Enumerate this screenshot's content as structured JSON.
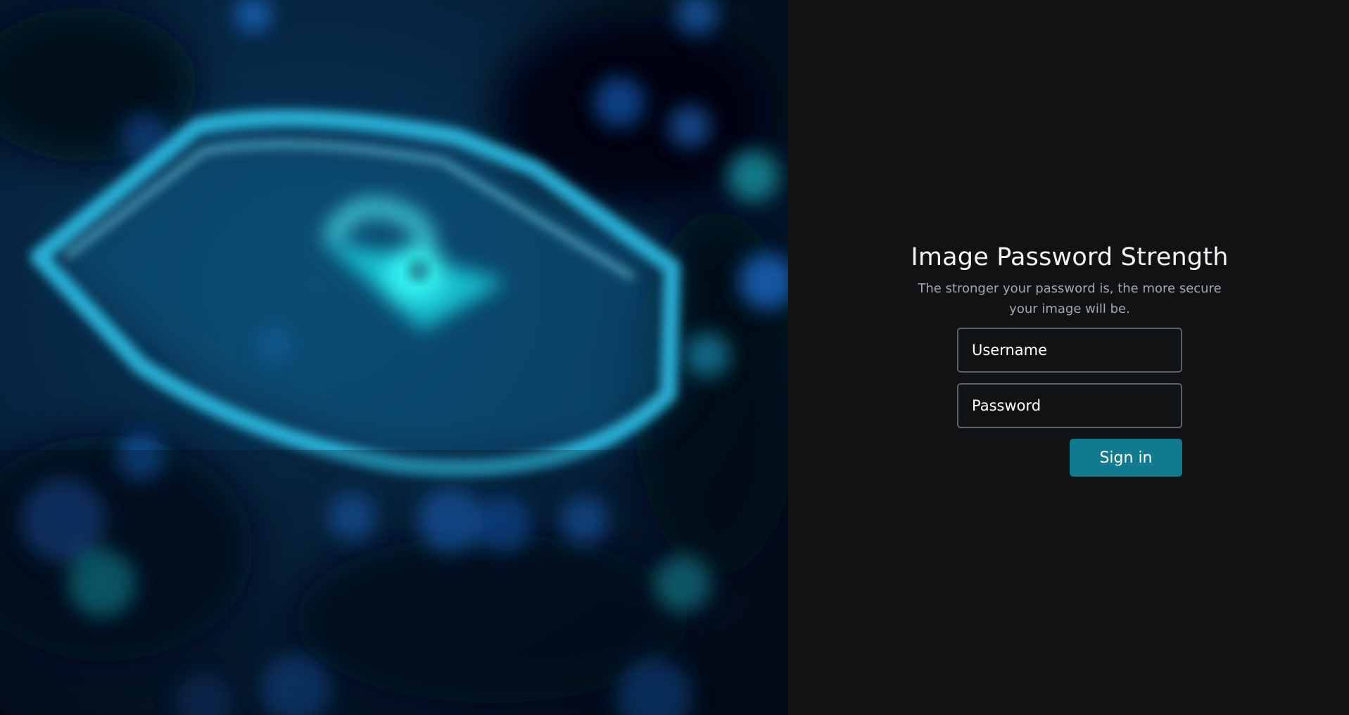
{
  "login": {
    "title": "Image Password Strength",
    "subtitle": "The stronger your password is, the more secure your image will be.",
    "username_placeholder": "Username",
    "password_placeholder": "Password",
    "signin_label": "Sign in"
  },
  "hero": {
    "icon": "shield-lock-icon",
    "accent": "#1fe0f0"
  },
  "colors": {
    "panel_bg": "#111214",
    "field_border": "#5c6067",
    "button_bg": "#127a8e",
    "title": "#f2f4f6",
    "subtitle": "#a3a8ae"
  }
}
